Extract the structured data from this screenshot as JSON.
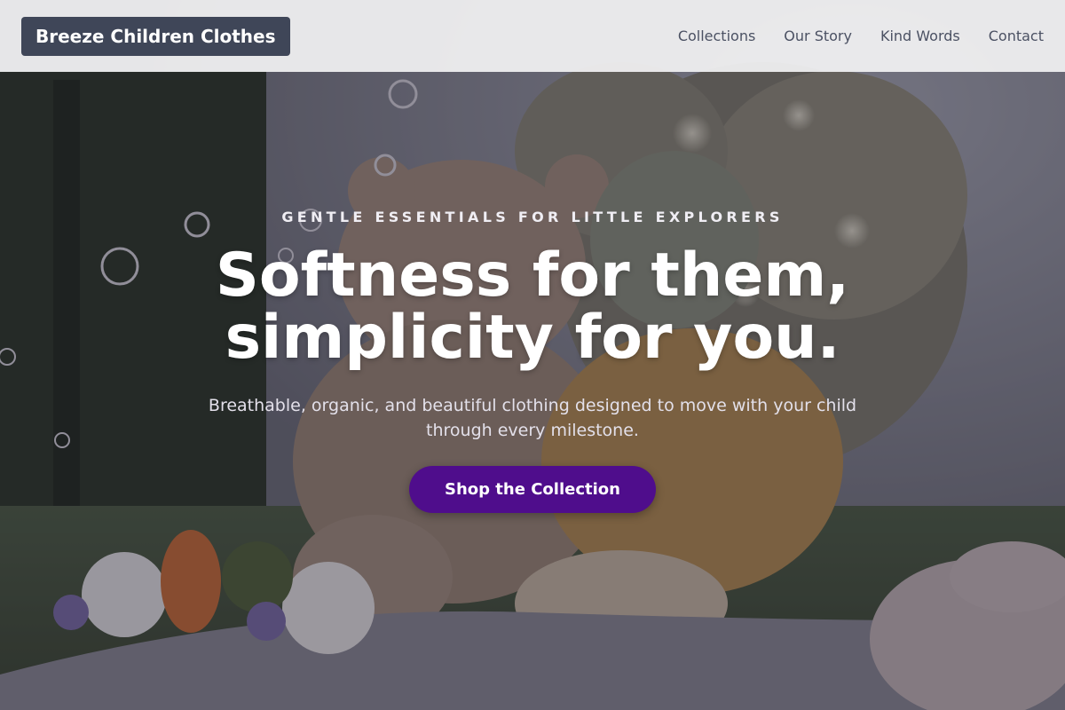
{
  "header": {
    "brand": "Breeze Children Clothes",
    "nav": [
      {
        "label": "Collections"
      },
      {
        "label": "Our Story"
      },
      {
        "label": "Kind Words"
      },
      {
        "label": "Contact"
      }
    ]
  },
  "hero": {
    "eyebrow": "GENTLE ESSENTIALS FOR LITTLE EXPLORERS",
    "headline_line1": "Softness for them,",
    "headline_line2": "simplicity for you.",
    "subtitle": "Breathable, organic, and beautiful clothing designed to move with your child through every milestone.",
    "cta_label": "Shop the Collection",
    "background_image": "photo-teddy-bear-and-toddler-with-bubbles"
  },
  "colors": {
    "brand_bg": "#3f4658",
    "header_bg": "#f2f2f3",
    "nav_text": "#4b5163",
    "cta_bg": "#4f0d8c",
    "hero_text": "#ffffff"
  }
}
